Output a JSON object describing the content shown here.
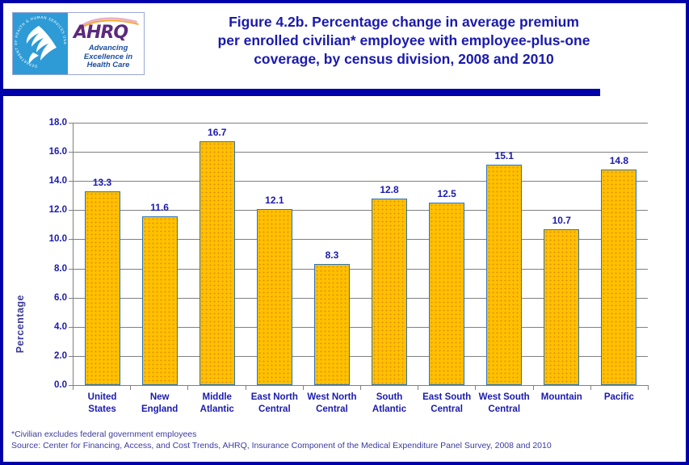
{
  "header": {
    "title_lines": [
      "Figure 4.2b. Percentage change in average premium",
      "per enrolled civilian* employee with employee-plus-one",
      "coverage, by census division, 2008 and 2010"
    ],
    "logo": {
      "seal_name": "DEPARTMENT OF HEALTH & HUMAN SERVICES USA",
      "wordmark": "AHRQ",
      "tagline_lines": [
        "Advancing",
        "Excellence in",
        "Health Care"
      ]
    }
  },
  "chart_data": {
    "type": "bar",
    "title": "Figure 4.2b. Percentage change in average premium per enrolled civilian* employee with employee-plus-one coverage, by census division, 2008 and 2010",
    "xlabel": "",
    "ylabel": "Percentage",
    "categories": [
      "United States",
      "New England",
      "Middle Atlantic",
      "East North Central",
      "West North Central",
      "South Atlantic",
      "East South Central",
      "West South Central",
      "Mountain",
      "Pacific"
    ],
    "category_lines": [
      [
        "United",
        "States"
      ],
      [
        "New",
        "England"
      ],
      [
        "Middle",
        "Atlantic"
      ],
      [
        "East North",
        "Central"
      ],
      [
        "West North",
        "Central"
      ],
      [
        "South",
        "Atlantic"
      ],
      [
        "East South",
        "Central"
      ],
      [
        "West South",
        "Central"
      ],
      [
        "Mountain"
      ],
      [
        "Pacific"
      ]
    ],
    "values": [
      13.3,
      11.6,
      16.7,
      12.1,
      8.3,
      12.8,
      12.5,
      15.1,
      10.7,
      14.8
    ],
    "data_labels": [
      "13.3",
      "11.6",
      "16.7",
      "12.1",
      "8.3",
      "12.8",
      "12.5",
      "15.1",
      "10.7",
      "14.8"
    ],
    "ylim": [
      0.0,
      18.0
    ],
    "ytick_step": 2.0,
    "ytick_labels": [
      "0.0",
      "2.0",
      "4.0",
      "6.0",
      "8.0",
      "10.0",
      "12.0",
      "14.0",
      "16.0",
      "18.0"
    ],
    "grid": true,
    "legend": null,
    "colors": {
      "bar_fill": "#FFC000",
      "bar_pattern_dot": "#E08C10",
      "bar_border": "#2E74B5",
      "text_blue": "#1A1AAE",
      "frame_blue": "#0000AA",
      "gridline": "#808080"
    }
  },
  "footer": {
    "note": "*Civilian excludes federal government employees",
    "source": "Source: Center for Financing, Access, and Cost Trends, AHRQ,  Insurance Component of the Medical Expenditure Panel Survey,  2008 and 2010"
  }
}
